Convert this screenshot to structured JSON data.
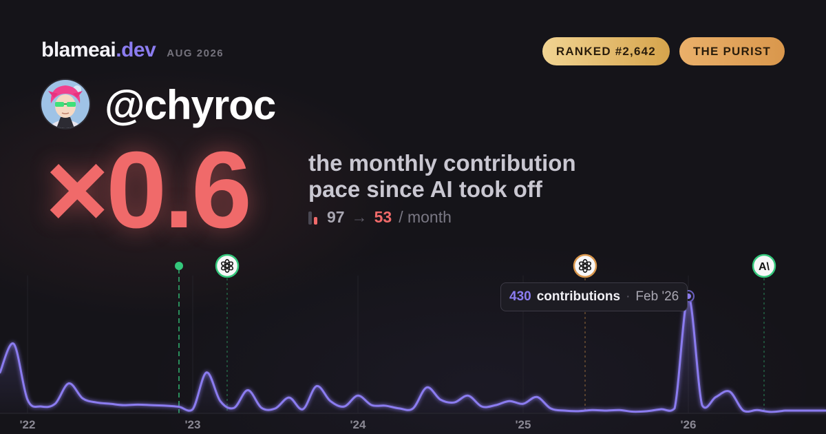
{
  "header": {
    "brand_name": "blameai",
    "brand_tld": ".dev",
    "period": "AUG 2026",
    "rank_badge": "RANKED #2,642",
    "title_badge": "THE PURIST"
  },
  "profile": {
    "handle": "@chyroc"
  },
  "headline": {
    "multiplier": "×0.6",
    "description_line1": "the monthly contribution",
    "description_line2": "pace since AI took off",
    "before": "97",
    "arrow": "→",
    "after": "53",
    "unit": "/ month"
  },
  "tooltip": {
    "value": "430",
    "label": "contributions",
    "separator": "·",
    "date": "Feb '26"
  },
  "colors": {
    "background": "#151419",
    "accent_purple": "#8b7cf0",
    "accent_red": "#f06a6a",
    "green_marker": "#34c77b",
    "openai_gold": "#d9974c",
    "badge_gold": "#e3b468"
  },
  "chart_data": {
    "type": "area",
    "x_unit": "month index from Nov 2021",
    "x": [
      0,
      1,
      2,
      3,
      4,
      5,
      6,
      7,
      8,
      9,
      10,
      11,
      12,
      13,
      14,
      15,
      16,
      17,
      18,
      19,
      20,
      21,
      22,
      23,
      24,
      25,
      26,
      27,
      28,
      29,
      30,
      31,
      32,
      33,
      34,
      35,
      36,
      37,
      38,
      39,
      40,
      41,
      42,
      43,
      44,
      45,
      46,
      47,
      48,
      49,
      50,
      51,
      52,
      53,
      54,
      55,
      56,
      57
    ],
    "values": [
      150,
      255,
      50,
      25,
      35,
      110,
      55,
      40,
      35,
      30,
      32,
      30,
      28,
      24,
      15,
      150,
      45,
      20,
      85,
      20,
      18,
      58,
      15,
      100,
      45,
      25,
      65,
      30,
      28,
      18,
      18,
      95,
      50,
      40,
      65,
      25,
      30,
      45,
      35,
      60,
      18,
      10,
      8,
      12,
      10,
      12,
      6,
      8,
      15,
      18,
      430,
      30,
      60,
      80,
      10,
      12,
      5,
      10
    ],
    "x_tick_labels": [
      "'22",
      "'23",
      "'24",
      "'25",
      "'26"
    ],
    "x_tick_positions": [
      2,
      14,
      26,
      38,
      50
    ],
    "ylim": [
      0,
      430
    ],
    "grid": "vertical",
    "markers": [
      {
        "x": 13,
        "icon": "green-dot",
        "style": "dashed"
      },
      {
        "x": 16.5,
        "icon": "openai-icon",
        "style": "dotted"
      },
      {
        "x": 42.5,
        "icon": "openai-icon",
        "style": "dotted"
      },
      {
        "x": 55.5,
        "icon": "anthropic-icon",
        "style": "dotted"
      }
    ],
    "highlight_point": {
      "x": 50,
      "value": 430
    }
  }
}
